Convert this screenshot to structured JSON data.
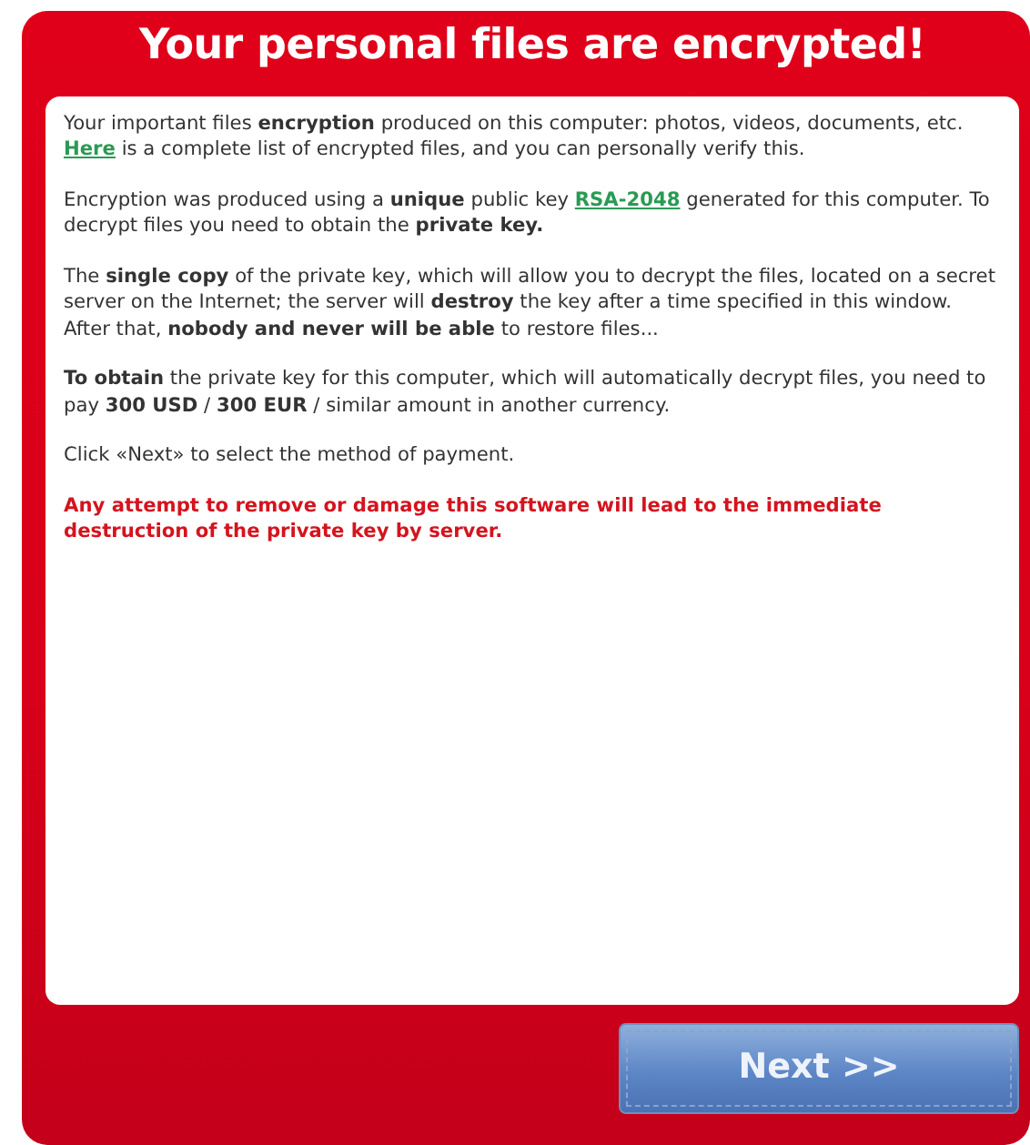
{
  "window": {
    "title": "Your personal files are encrypted!"
  },
  "paragraphs": [
    {
      "kind": "normal",
      "parts": [
        {
          "kind": "text",
          "text": "Your important files **encryption** produced on this computer: photos, videos, documents, etc. "
        },
        {
          "kind": "link",
          "text": "Here"
        },
        {
          "kind": "text",
          "text": " is a complete list of encrypted files, and you can personally verify this."
        }
      ]
    },
    {
      "kind": "normal",
      "parts": [
        {
          "kind": "text",
          "text": "Encryption was produced using a **unique** public key "
        },
        {
          "kind": "link",
          "text": "RSA-2048"
        },
        {
          "kind": "text",
          "text": " generated for this computer. To decrypt files you need to obtain the **private key.**"
        }
      ]
    },
    {
      "kind": "normal",
      "parts": [
        {
          "kind": "text",
          "text": "The **single copy** of the private key, which will allow you to decrypt the files, located on a secret server on the Internet; the server will **destroy** the key after a time specified in this window. After that, **nobody and never will be able** to restore files..."
        }
      ]
    },
    {
      "kind": "normal",
      "parts": [
        {
          "kind": "text",
          "text": "**To obtain** the private key for this computer, which will automatically decrypt files, you need to pay **300 USD** / **300 EUR** / similar amount in another currency."
        }
      ]
    },
    {
      "kind": "normal",
      "parts": [
        {
          "kind": "text",
          "text": "Click «Next» to select the method of payment."
        }
      ]
    },
    {
      "kind": "warning",
      "parts": [
        {
          "kind": "text",
          "text": "Any attempt to remove or damage this software will lead to the immediate destruction of the private key by server."
        }
      ]
    }
  ],
  "buttons": [
    {
      "label": "Next >>"
    }
  ]
}
